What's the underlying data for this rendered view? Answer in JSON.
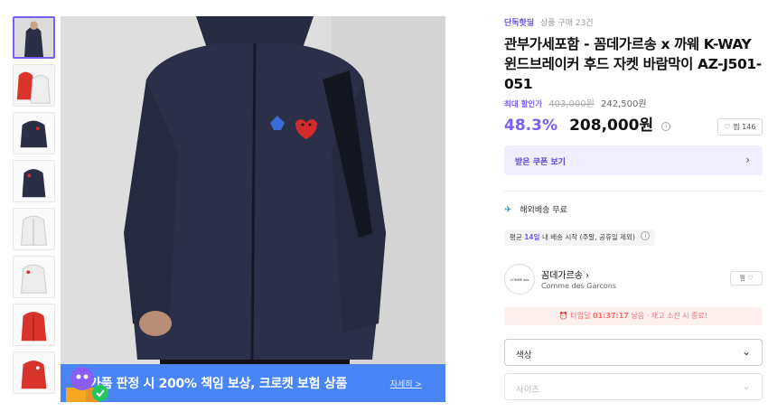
{
  "gallery": {
    "thumbnails": [
      {
        "color": "#2a2f45",
        "label": "navy-front"
      },
      {
        "color": "#d9342b",
        "label": "red-white"
      },
      {
        "color": "#2a2f45",
        "label": "navy-flat"
      },
      {
        "color": "#2a2f45",
        "label": "navy-side"
      },
      {
        "color": "#eeeeee",
        "label": "white-front"
      },
      {
        "color": "#eeeeee",
        "label": "white-flat"
      },
      {
        "color": "#d9342b",
        "label": "red-front"
      },
      {
        "color": "#d9342b",
        "label": "red-flat"
      }
    ],
    "banner_text": "가품 판정 시 200% 책임 보상, 크로켓 보험 상품",
    "banner_link": "자세히 >"
  },
  "product": {
    "tag": "단독핫딜",
    "sold_count": "상품 구매 23건",
    "title": "관부가세포함 - 꼼데가르송 x 까웨 K-WAY 윈드브레이커 후드 자켓 바람막이 AZ-J501-051",
    "max_discount_label": "최대 할인가",
    "original_price": "403,000원",
    "mid_price": "242,500원",
    "discount_rate": "48.3%",
    "final_price": "208,000원",
    "wish_count": "찜 146",
    "coupon_label": "받은 쿠폰 보기"
  },
  "shipping": {
    "label": "해외배송 무료",
    "delivery_prefix": "평균",
    "delivery_days": "14일",
    "delivery_suffix": "내 배송 시작 (주말, 공휴일 제외)"
  },
  "brand": {
    "logo_text": "COMME des GARÇONS",
    "name": "꼼데가르송",
    "sub": "Comme des Garcons",
    "follow": "찜"
  },
  "deal": {
    "prefix": "타임딜",
    "timer": "01:37:17",
    "suffix": "남음 · 재고 소진 시 종료!"
  },
  "options": {
    "color_label": "색상",
    "size_label": "사이즈"
  },
  "colors": {
    "accent": "#7b5cf5",
    "banner": "#4a85f7",
    "deal": "#ff6b6b"
  }
}
